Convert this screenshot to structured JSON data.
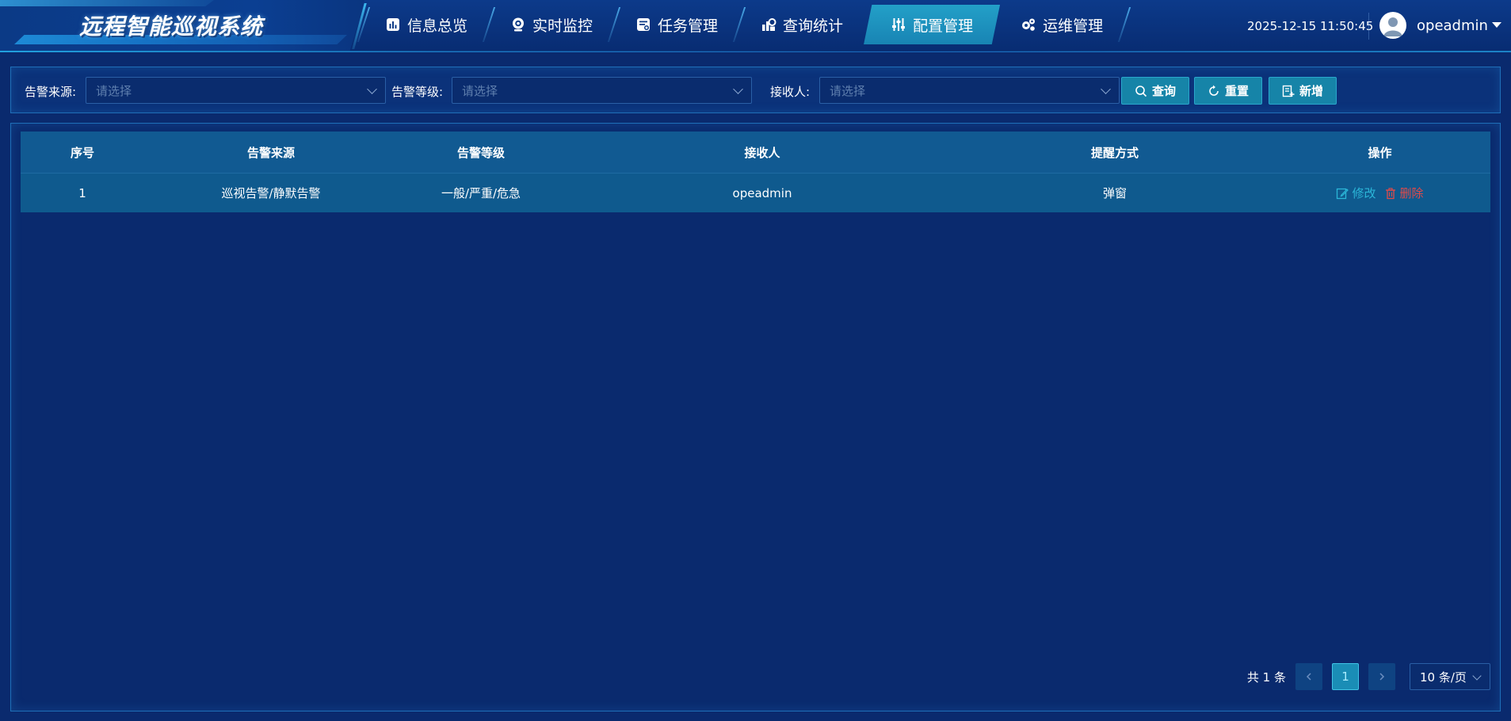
{
  "header": {
    "app_title": "远程智能巡视系统",
    "nav": [
      {
        "label": "信息总览",
        "icon": "chart-icon",
        "active": false
      },
      {
        "label": "实时监控",
        "icon": "camera-icon",
        "active": false
      },
      {
        "label": "任务管理",
        "icon": "task-icon",
        "active": false
      },
      {
        "label": "查询统计",
        "icon": "stats-icon",
        "active": false
      },
      {
        "label": "配置管理",
        "icon": "sliders-icon",
        "active": true
      },
      {
        "label": "运维管理",
        "icon": "gears-icon",
        "active": false
      }
    ],
    "datetime": "2025-12-15 11:50:45",
    "username": "opeadmin"
  },
  "filters": {
    "source_label": "告警来源:",
    "source_placeholder": "请选择",
    "level_label": "告警等级:",
    "level_placeholder": "请选择",
    "receiver_label": "接收人:",
    "receiver_placeholder": "请选择",
    "query_label": "查询",
    "reset_label": "重置",
    "add_label": "新增"
  },
  "table": {
    "columns": [
      "序号",
      "告警来源",
      "告警等级",
      "接收人",
      "提醒方式",
      "操作"
    ],
    "rows": [
      {
        "index": "1",
        "source": "巡视告警/静默告警",
        "level": "一般/严重/危急",
        "receiver": "opeadmin",
        "method": "弹窗",
        "edit": "修改",
        "delete": "删除"
      }
    ]
  },
  "pagination": {
    "total": "共 1 条",
    "current_page": "1",
    "page_size": "10 条/页"
  },
  "colors": {
    "background": "#0a2a6e",
    "accent": "#1684a8",
    "edit": "#2bb6d8",
    "delete": "#e04a4a"
  }
}
